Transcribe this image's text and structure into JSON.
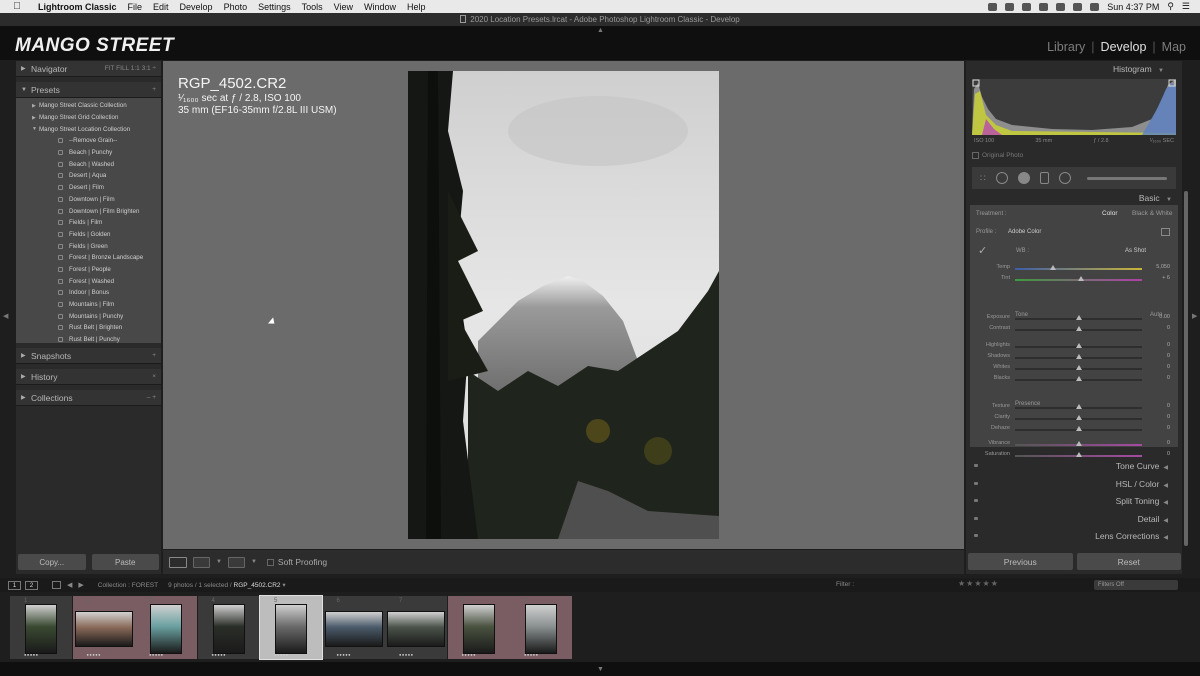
{
  "menubar": {
    "app_name": "Lightroom Classic",
    "items": [
      "File",
      "Edit",
      "Develop",
      "Photo",
      "Settings",
      "Tools",
      "View",
      "Window",
      "Help"
    ],
    "clock": "Sun 4:37 PM"
  },
  "window": {
    "title": "2020 Location Presets.lrcat - Adobe Photoshop Lightroom Classic - Develop"
  },
  "identity": {
    "brand": "MANGO STREET",
    "modules": [
      "Library",
      "Develop",
      "Map"
    ],
    "active_module": "Develop"
  },
  "left_panel": {
    "navigator": {
      "label": "Navigator",
      "zoom_options": "FIT  FILL  1:1  3:1 ÷"
    },
    "presets": {
      "label": "Presets",
      "add": "+",
      "collections": [
        "Mango Street Classic Collection",
        "Mango Street Grid Collection",
        "Mango Street Location Collection"
      ],
      "items": [
        "--Remove Grain--",
        "Beach | Punchy",
        "Beach | Washed",
        "Desert | Aqua",
        "Desert | Film",
        "Downtown | Film",
        "Downtown | Film Brighten",
        "Fields | Film",
        "Fields | Golden",
        "Fields | Green",
        "Forest | Bronze Landscape",
        "Forest | People",
        "Forest | Washed",
        "Indoor | Bonus",
        "Mountains | Film",
        "Mountains | Punchy",
        "Rust Belt | Brighten",
        "Rust Belt | Punchy"
      ]
    },
    "snapshots": {
      "label": "Snapshots",
      "right": "+"
    },
    "history": {
      "label": "History",
      "right": "×"
    },
    "collections": {
      "label": "Collections",
      "right": "– +"
    },
    "copy_button": "Copy...",
    "paste_button": "Paste"
  },
  "center": {
    "filename": "RGP_4502.CR2",
    "exposure_line": "¹⁄₁₆₀₀ sec at ƒ / 2.8, ISO 100",
    "lens_line": "35 mm (EF16-35mm f/2.8L III USM)"
  },
  "toolbar": {
    "soft_proofing": "Soft Proofing"
  },
  "right_panel": {
    "histogram_label": "Histogram",
    "hist_info": {
      "iso": "ISO 100",
      "focal": "35 mm",
      "aperture": "ƒ / 2.8",
      "shutter": "¹⁄₁₆₀₀ SEC"
    },
    "original_photo": "Original Photo",
    "basic_label": "Basic",
    "treatment_label": "Treatment :",
    "treatment_color": "Color",
    "treatment_bw": "Black & White",
    "profile_label": "Profile :",
    "profile_value": "Adobe Color",
    "wb_label": "WB :",
    "wb_value": "As Shot",
    "tone_label": "Tone",
    "tone_auto": "Auto",
    "presence_label": "Presence",
    "sliders": {
      "temp": {
        "label": "Temp",
        "value": "5,050",
        "pos": 0.3
      },
      "tint": {
        "label": "Tint",
        "value": "+ 6",
        "pos": 0.52
      },
      "exposure": {
        "label": "Exposure",
        "value": "0.00",
        "pos": 0.5
      },
      "contrast": {
        "label": "Contrast",
        "value": "0",
        "pos": 0.5
      },
      "highlights": {
        "label": "Highlights",
        "value": "0",
        "pos": 0.5
      },
      "shadows": {
        "label": "Shadows",
        "value": "0",
        "pos": 0.5
      },
      "whites": {
        "label": "Whites",
        "value": "0",
        "pos": 0.5
      },
      "blacks": {
        "label": "Blacks",
        "value": "0",
        "pos": 0.5
      },
      "texture": {
        "label": "Texture",
        "value": "0",
        "pos": 0.5
      },
      "clarity": {
        "label": "Clarity",
        "value": "0",
        "pos": 0.5
      },
      "dehaze": {
        "label": "Dehaze",
        "value": "0",
        "pos": 0.5
      },
      "vibrance": {
        "label": "Vibrance",
        "value": "0",
        "pos": 0.5
      },
      "saturation": {
        "label": "Saturation",
        "value": "0",
        "pos": 0.5
      }
    },
    "collapsed_sections": [
      "Tone Curve",
      "HSL / Color",
      "Split Toning",
      "Detail",
      "Lens Corrections"
    ],
    "previous_button": "Previous",
    "reset_button": "Reset"
  },
  "filmbar": {
    "page1": "1",
    "page2": "2",
    "collection": "Collection : FOREST",
    "count": "9 photos / 1 selected /",
    "selected_file": "RGP_4502.CR2",
    "filter_label": "Filter :",
    "filters_off": "Filters Off"
  },
  "filmstrip": {
    "numbers": [
      "1",
      "2",
      "3",
      "4",
      "5",
      "6",
      "7",
      "8",
      "9"
    ],
    "selected_index": 5
  }
}
